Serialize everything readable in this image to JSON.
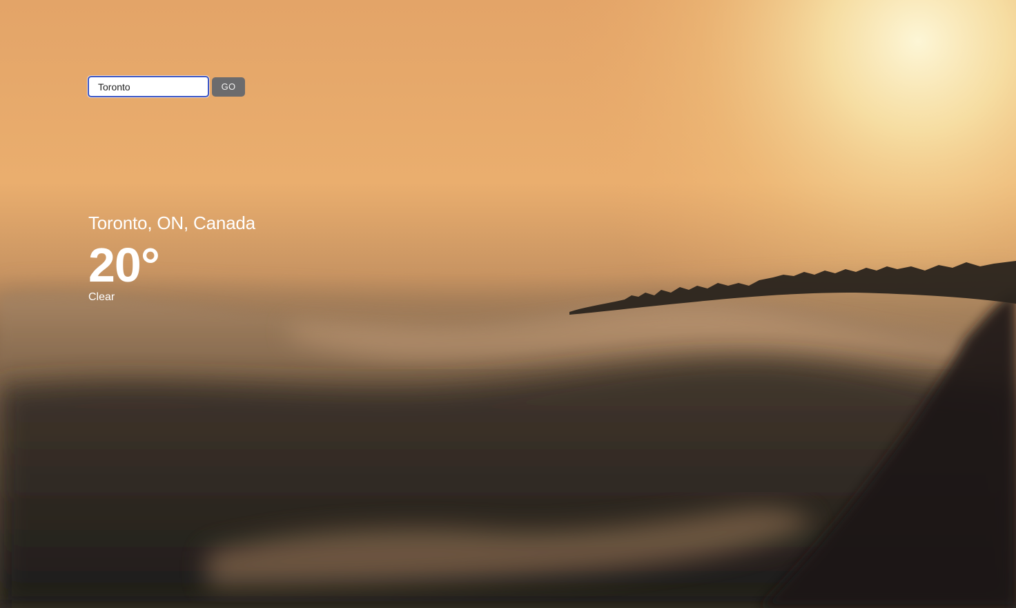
{
  "search": {
    "value": "Toronto",
    "button_label": "GO"
  },
  "weather": {
    "location": "Toronto, ON, Canada",
    "temperature": "20°",
    "condition": "Clear"
  },
  "background": {
    "sky_top": "#e9a862",
    "sky_glow": "#fbf2cf",
    "horizon": "#b78a5e",
    "cloud": "#5b4a3a",
    "shadow": "#1d1b19"
  }
}
